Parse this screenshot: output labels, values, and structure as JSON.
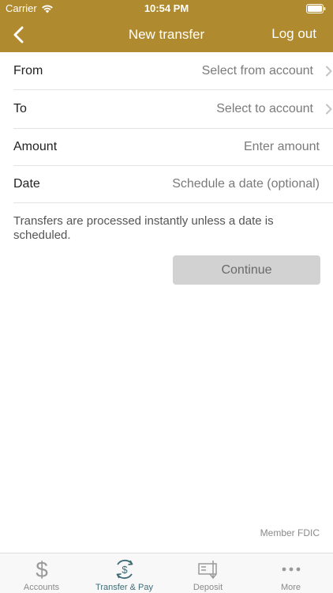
{
  "status_bar": {
    "carrier": "Carrier",
    "time": "10:54 PM"
  },
  "nav": {
    "title": "New transfer",
    "logout_label": "Log out"
  },
  "form": {
    "from": {
      "label": "From",
      "value": "Select from account"
    },
    "to": {
      "label": "To",
      "value": "Select to account"
    },
    "amount": {
      "label": "Amount",
      "value": "Enter amount"
    },
    "date": {
      "label": "Date",
      "value": "Schedule a date (optional)"
    }
  },
  "info_text": "Transfers are processed instantly unless a date is scheduled.",
  "continue_label": "Continue",
  "footer": {
    "fdic": "Member FDIC"
  },
  "tabs": [
    {
      "label": "Accounts",
      "icon": "dollar-icon",
      "active": false
    },
    {
      "label": "Transfer & Pay",
      "icon": "transfer-pay-icon",
      "active": true
    },
    {
      "label": "Deposit",
      "icon": "deposit-check-icon",
      "active": false
    },
    {
      "label": "More",
      "icon": "more-dots-icon",
      "active": false
    }
  ],
  "colors": {
    "header": "#b08a2e",
    "active_tab": "#3f6c77",
    "inactive_tab": "#8a8a8a",
    "button_disabled": "#d2d2d2"
  }
}
